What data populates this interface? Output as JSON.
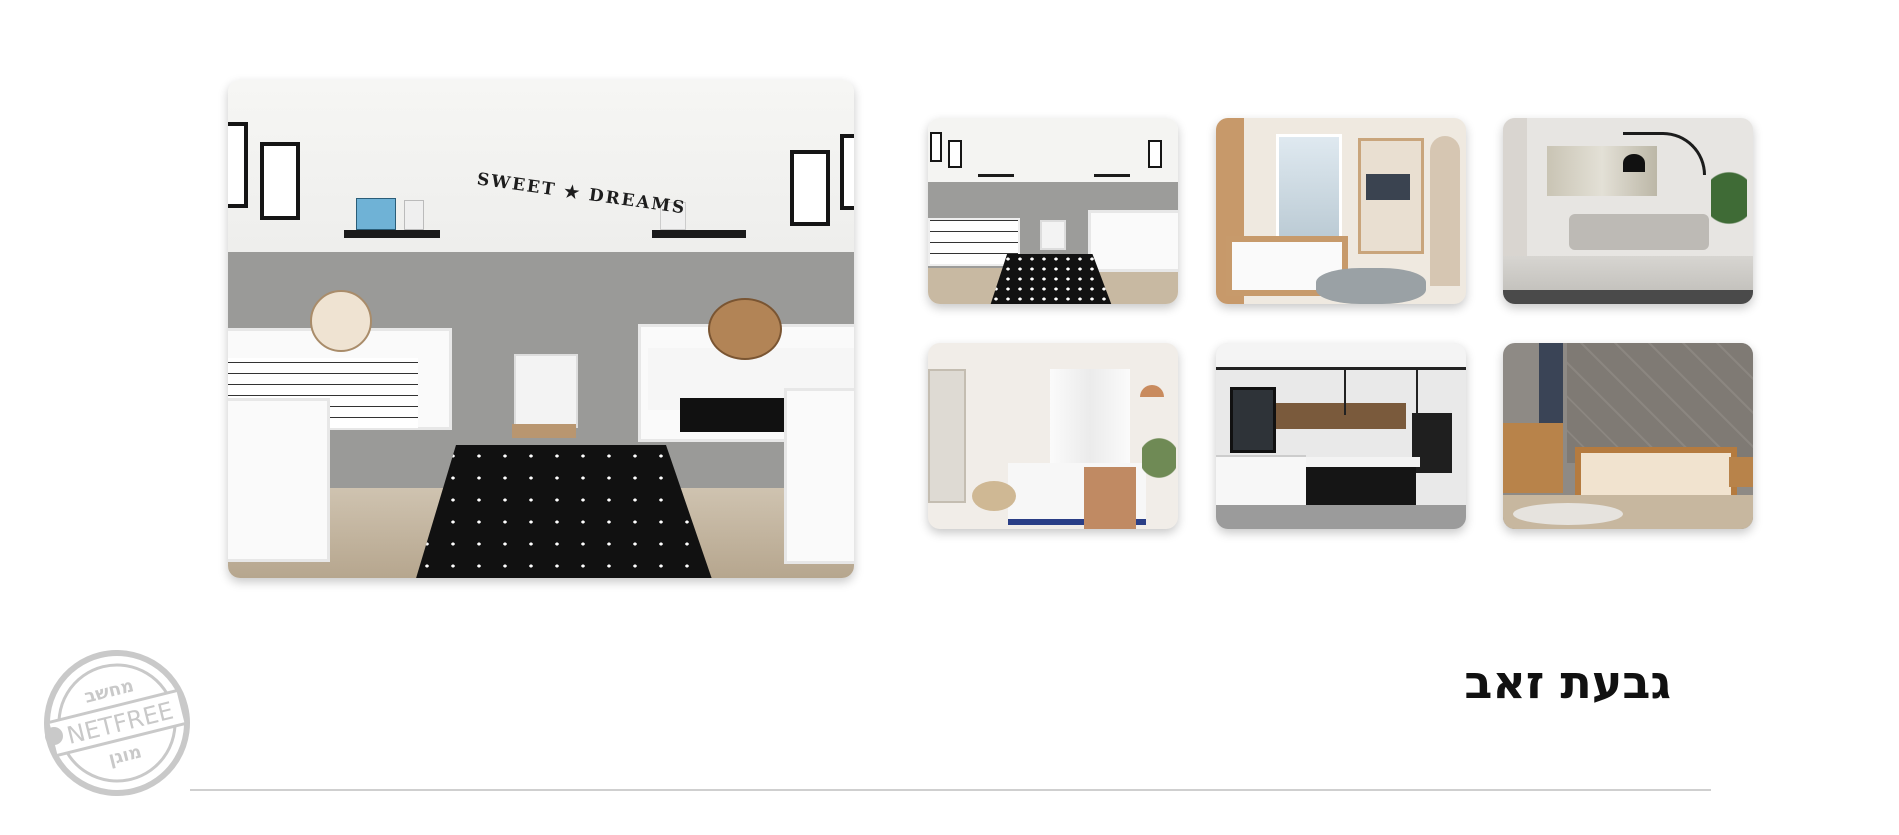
{
  "gallery": {
    "main_photo": {
      "alt": "",
      "garland_text": "SWEET ★ DREAMS"
    },
    "thumbnails": [
      {
        "key": "kids-room",
        "alt": ""
      },
      {
        "key": "bunk-room",
        "alt": ""
      },
      {
        "key": "living-room",
        "alt": ""
      },
      {
        "key": "bedroom-white",
        "alt": ""
      },
      {
        "key": "kitchen",
        "alt": ""
      },
      {
        "key": "bedroom-wood",
        "alt": ""
      }
    ]
  },
  "project": {
    "title": "גבעת זאב"
  },
  "stamp": {
    "top_text": "מחשב",
    "middle_text": "NETFREE",
    "bottom_text": "מוגן"
  },
  "colors": {
    "title": "#111111",
    "divider": "#cfcfcf",
    "stamp": "#c9c9c9"
  }
}
